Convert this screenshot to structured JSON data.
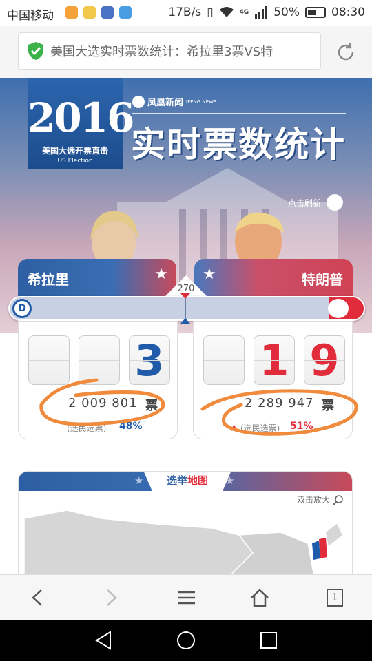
{
  "status_bar": {
    "carrier": "中国移动",
    "network_speed": "17B/s",
    "network_type": "4G",
    "battery": "50%",
    "time": "08:30"
  },
  "browser": {
    "url_title": "美国大选实时票数统计：希拉里3票VS特",
    "tab_count": "1"
  },
  "hero": {
    "year": "2016",
    "subtitle": "美国大选开票直击",
    "subtitle_en": "US Election",
    "brand": "凤凰新闻",
    "brand_en": "IFENG NEWS",
    "headline": "实时票数统计",
    "refresh_label": "点击刷新"
  },
  "candidates": {
    "clinton": {
      "name": "希拉里",
      "electoral_digits": [
        "",
        "",
        "3"
      ],
      "popular_votes": "2 009 801",
      "votes_unit": "票",
      "popular_label": "(选民选票)",
      "percent": "48%"
    },
    "trump": {
      "name": "特朗普",
      "electoral_digits": [
        "",
        "1",
        "9"
      ],
      "popular_votes": "2 289 947",
      "votes_unit": "票",
      "popular_label": "(选民选票)",
      "percent": "51%"
    },
    "threshold": "270"
  },
  "map": {
    "title_a": "选举",
    "title_b": "地图",
    "zoom_hint": "双击放大"
  },
  "colors": {
    "dem_blue": "#1f5ba8",
    "rep_red": "#e12d3b",
    "annotation_orange": "#f08a3c"
  }
}
